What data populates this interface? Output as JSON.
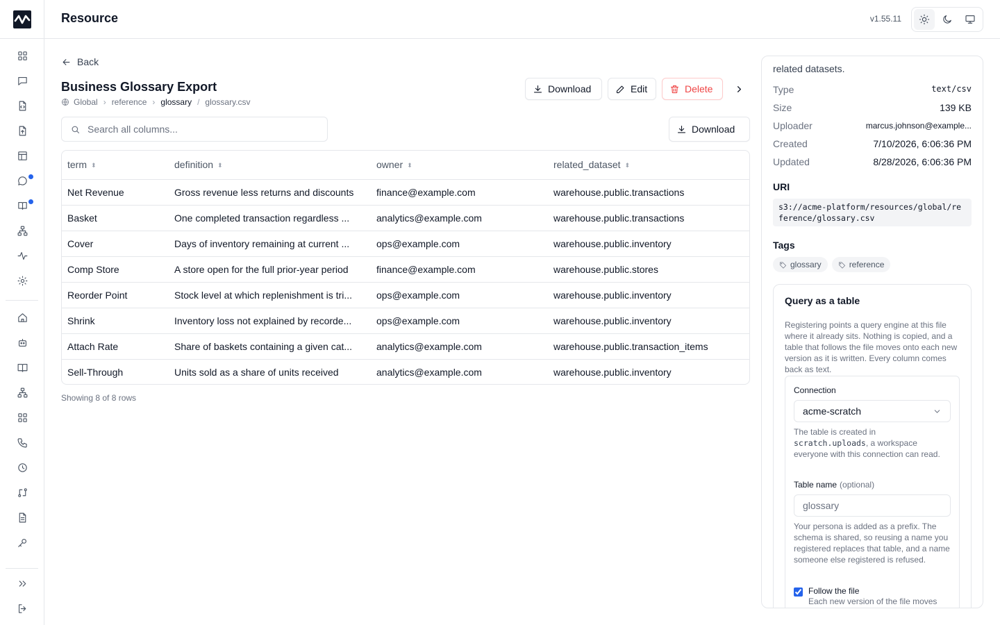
{
  "app": {
    "title": "Resource",
    "version": "v1.55.11"
  },
  "rail": {
    "icons": [
      "grid-icon",
      "chat-icon",
      "file-code-icon",
      "file-upload-icon",
      "table-icon",
      "message-icon",
      "book-icon",
      "hierarchy-icon",
      "activity-icon",
      "settings-icon",
      "home-icon",
      "robot-icon",
      "book-open-icon",
      "sitemap-icon",
      "apps-icon",
      "phone-icon",
      "clock-icon",
      "git-compare-icon",
      "document-icon",
      "key-icon",
      "expand-icon",
      "logout-icon"
    ],
    "accent": "#2563eb"
  },
  "theme": {
    "options": [
      "light",
      "dark",
      "system"
    ],
    "selected": "light"
  },
  "nav": {
    "back_label": "Back"
  },
  "resource": {
    "title": "Business Glossary Export",
    "breadcrumb": {
      "scope": "Global",
      "path1": "reference",
      "path2": "glossary",
      "file": "glossary.csv"
    }
  },
  "actions": {
    "download": "Download",
    "edit": "Edit",
    "delete": "Delete",
    "danger_color": "#ef4444"
  },
  "search": {
    "placeholder": "Search all columns...",
    "value": "",
    "download": "Download"
  },
  "table": {
    "columns": [
      "term",
      "definition",
      "owner",
      "related_dataset"
    ],
    "rows": [
      [
        "Net Revenue",
        "Gross revenue less returns and discounts",
        "finance@example.com",
        "warehouse.public.transactions"
      ],
      [
        "Basket",
        "One completed transaction regardless ...",
        "analytics@example.com",
        "warehouse.public.transactions"
      ],
      [
        "Cover",
        "Days of inventory remaining at current ...",
        "ops@example.com",
        "warehouse.public.inventory"
      ],
      [
        "Comp Store",
        "A store open for the full prior-year period",
        "finance@example.com",
        "warehouse.public.stores"
      ],
      [
        "Reorder Point",
        "Stock level at which replenishment is tri...",
        "ops@example.com",
        "warehouse.public.inventory"
      ],
      [
        "Shrink",
        "Inventory loss not explained by recorde...",
        "ops@example.com",
        "warehouse.public.inventory"
      ],
      [
        "Attach Rate",
        "Share of baskets containing a given cat...",
        "analytics@example.com",
        "warehouse.public.transaction_items"
      ],
      [
        "Sell-Through",
        "Units sold as a share of units received",
        "analytics@example.com",
        "warehouse.public.inventory"
      ]
    ],
    "row_count": "Showing 8 of 8 rows"
  },
  "details": {
    "description_end": "related datasets.",
    "meta": [
      {
        "key": "Type",
        "value": "text/csv"
      },
      {
        "key": "Size",
        "value": "139 KB"
      },
      {
        "key": "Uploader",
        "value": "marcus.johnson@example..."
      },
      {
        "key": "Created",
        "value": "7/10/2026, 6:06:36 PM"
      },
      {
        "key": "Updated",
        "value": "8/28/2026, 6:06:36 PM"
      }
    ],
    "uri_label": "URI",
    "uri": "s3://acme-platform/resources/global/reference/glossary.csv",
    "tags_label": "Tags",
    "tags": [
      "glossary",
      "reference"
    ]
  },
  "query": {
    "title": "Query as a table",
    "description": "Registering points a query engine at this file where it already sits. Nothing is copied, and a table that follows the file moves onto each new version as it is written. Every column comes back as text.",
    "connection_label": "Connection",
    "connection_value": "acme-scratch",
    "connection_help_pre": "The table is created in",
    "connection_help_code": "scratch.uploads",
    "connection_help_post": ", a workspace everyone with this connection can read.",
    "table_name_label": "Table name",
    "table_name_optional": "(optional)",
    "table_name_placeholder": "glossary",
    "table_name_help": "Your persona is added as a prefix. The schema is shared, so reusing a name you registered replaces that table, and a name someone else registered is refused.",
    "follow_label": "Follow the file",
    "follow_sub": "Each new version of the file moves",
    "follow_checked": true
  }
}
